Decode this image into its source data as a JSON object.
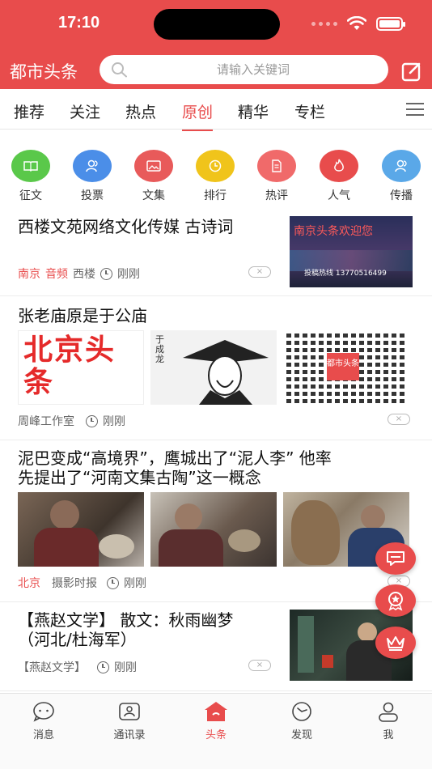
{
  "status": {
    "time": "17:10"
  },
  "header": {
    "title": "都市头条",
    "search_placeholder": "请输入关键词"
  },
  "tabs": [
    {
      "label": "推荐",
      "active": false
    },
    {
      "label": "关注",
      "active": false
    },
    {
      "label": "热点",
      "active": false
    },
    {
      "label": "原创",
      "active": true
    },
    {
      "label": "精华",
      "active": false
    },
    {
      "label": "专栏",
      "active": false
    }
  ],
  "categories": [
    {
      "label": "征文",
      "icon": "book-icon",
      "color": "#5ac84a"
    },
    {
      "label": "投票",
      "icon": "users-icon",
      "color": "#4b8ee8"
    },
    {
      "label": "文集",
      "icon": "image-icon",
      "color": "#e85a5a"
    },
    {
      "label": "排行",
      "icon": "clock-icon",
      "color": "#f0c41b"
    },
    {
      "label": "热评",
      "icon": "document-icon",
      "color": "#f06a6a"
    },
    {
      "label": "人气",
      "icon": "flame-icon",
      "color": "#e84c4c"
    },
    {
      "label": "传播",
      "icon": "users-icon",
      "color": "#5aa8e8"
    }
  ],
  "articles": [
    {
      "title": "西楼文苑网络文化传媒 古诗词",
      "tags": [
        "南京",
        "音频"
      ],
      "author": "西楼",
      "time": "刚刚",
      "thumb_text_top": "南京头条欢迎您",
      "thumb_text_bottom": "投稿热线  13770516499"
    },
    {
      "title": "张老庙原是于公庙",
      "author": "周峰工作室",
      "time": "刚刚",
      "img1_text": "北京头条",
      "img2_text": "于成龙",
      "img3_text": "都市头条"
    },
    {
      "title_line1": "泥巴变成“高境界”，鹰城出了“泥人李” 他率",
      "title_line2": "先提出了“河南文集古陶”这一概念",
      "tags": [
        "北京"
      ],
      "author": "摄影时报",
      "time": "刚刚"
    },
    {
      "title_line1": "【燕赵文学】 散文：秋雨幽梦",
      "title_line2": "（河北/杜海军）",
      "author": "【燕赵文学】",
      "time": "刚刚"
    }
  ],
  "dislike_label": "×",
  "bottom_nav": [
    {
      "label": "消息",
      "icon": "chat-icon"
    },
    {
      "label": "通讯录",
      "icon": "contacts-icon"
    },
    {
      "label": "头条",
      "icon": "home-icon",
      "active": true
    },
    {
      "label": "发现",
      "icon": "compass-icon"
    },
    {
      "label": "我",
      "icon": "profile-icon"
    }
  ],
  "colors": {
    "brand": "#e84c4c"
  }
}
